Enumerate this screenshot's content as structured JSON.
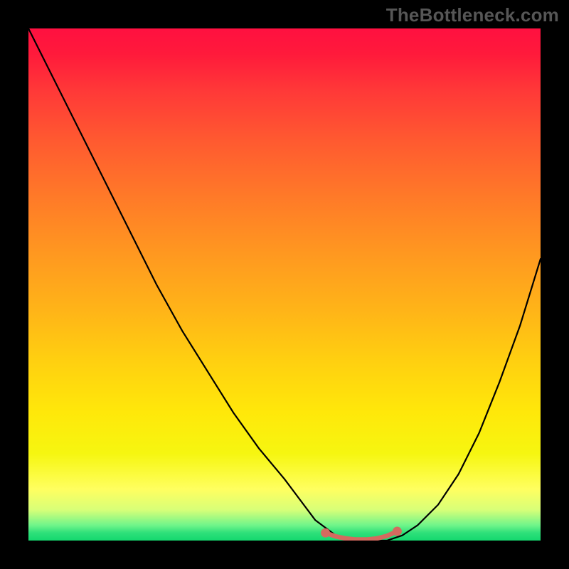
{
  "watermark": "TheBottleneck.com",
  "chart_data": {
    "type": "line",
    "title": "",
    "xlabel": "",
    "ylabel": "",
    "xlim": [
      0,
      100
    ],
    "ylim": [
      0,
      100
    ],
    "legend": false,
    "grid": false,
    "background_gradient": {
      "top_color": "#ff1040",
      "bottom_color": "#14d86e",
      "direction": "vertical"
    },
    "series": [
      {
        "name": "bottleneck-curve",
        "color": "#000000",
        "x": [
          0,
          5,
          10,
          15,
          20,
          25,
          30,
          35,
          40,
          45,
          50,
          53,
          56,
          60,
          63,
          66,
          70,
          73,
          76,
          80,
          84,
          88,
          92,
          96,
          100
        ],
        "y": [
          100,
          90,
          80,
          70,
          60,
          50,
          41,
          33,
          25,
          18,
          12,
          8,
          4,
          1,
          0,
          0,
          0,
          1,
          3,
          7,
          13,
          21,
          31,
          42,
          55
        ]
      }
    ],
    "markers": {
      "name": "optimal-range",
      "color": "#d46a5f",
      "x": [
        58,
        60,
        62,
        64,
        66,
        68,
        70,
        72
      ],
      "y": [
        1.5,
        0.8,
        0.4,
        0.2,
        0.2,
        0.4,
        0.9,
        1.8
      ]
    }
  }
}
